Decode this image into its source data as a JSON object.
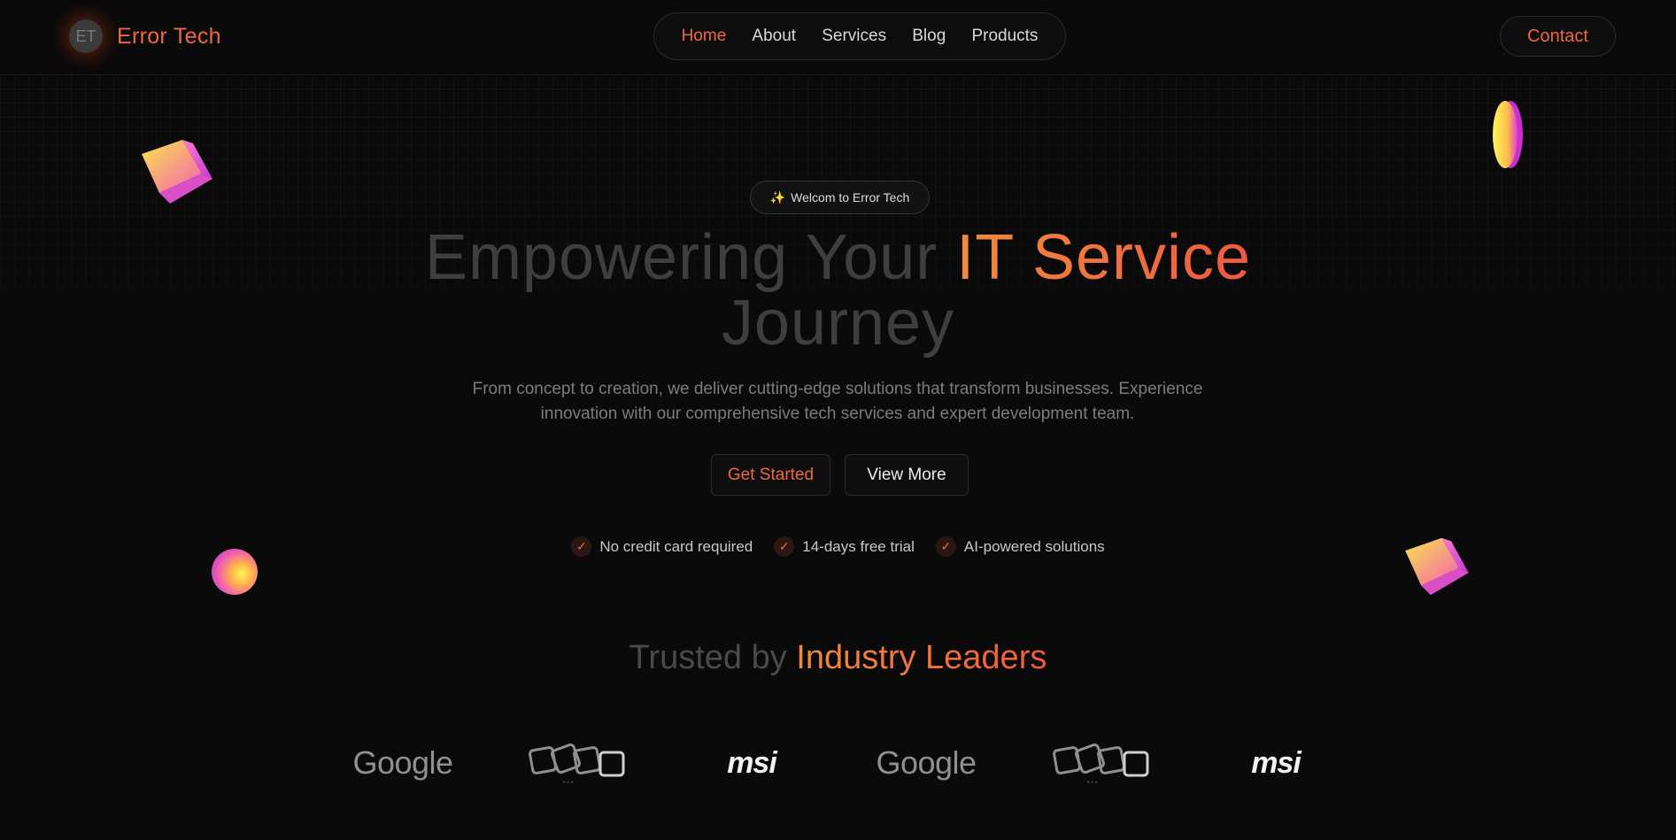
{
  "header": {
    "logo_initials": "ET",
    "logo_text": "Error Tech",
    "nav": [
      {
        "label": "Home",
        "active": true
      },
      {
        "label": "About",
        "active": false
      },
      {
        "label": "Services",
        "active": false
      },
      {
        "label": "Blog",
        "active": false
      },
      {
        "label": "Products",
        "active": false
      }
    ],
    "contact_label": "Contact"
  },
  "hero": {
    "badge_icon": "sparkles-icon",
    "badge_text": "Welcom to Error Tech",
    "title_part1": "Empowering Your ",
    "title_accent": "IT Service",
    "title_part2": "Journey",
    "subtitle_line1": "From concept to creation, we deliver cutting-edge solutions that transform businesses. Experience",
    "subtitle_line2": "innovation with our comprehensive tech services and expert development team.",
    "primary_button": "Get Started",
    "secondary_button": "View More",
    "features": [
      "No credit card required",
      "14-days free trial",
      "AI-powered solutions"
    ]
  },
  "trusted": {
    "title_part1": "Trusted by ",
    "title_accent": "Industry Leaders",
    "logos": [
      "Google",
      "Microsoft-style squares",
      "msi",
      "Google",
      "Microsoft-style squares",
      "msi"
    ]
  },
  "colors": {
    "accent": "#f0673d",
    "background": "#0a0a0a"
  }
}
